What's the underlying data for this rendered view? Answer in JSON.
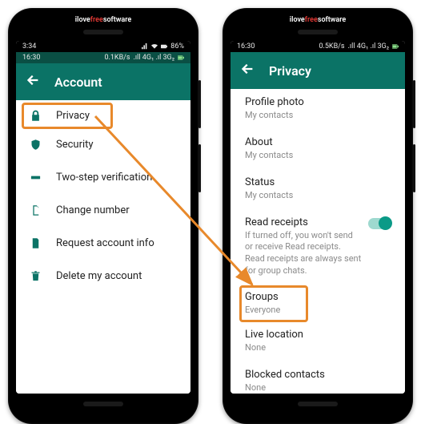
{
  "brand": {
    "pre": "ilove",
    "mid": "free",
    "post": "software"
  },
  "left": {
    "status1": {
      "time": "3:34",
      "battery": "86%"
    },
    "status2": {
      "time": "16:30",
      "net": "0.1KB/s",
      "sig": ".ıll 4G₁ .ıl 3G₂"
    },
    "header": {
      "title": "Account"
    },
    "items": [
      {
        "key": "privacy",
        "label": "Privacy"
      },
      {
        "key": "security",
        "label": "Security"
      },
      {
        "key": "twostep",
        "label": "Two-step verification"
      },
      {
        "key": "change",
        "label": "Change number"
      },
      {
        "key": "request",
        "label": "Request account info"
      },
      {
        "key": "delete",
        "label": "Delete my account"
      }
    ]
  },
  "right": {
    "status2": {
      "time": "16:30",
      "net": "0.5KB/s",
      "sig": ".ıll 4G₁ .ıl 3G₂"
    },
    "header": {
      "title": "Privacy"
    },
    "sections": {
      "profile": {
        "label": "Profile photo",
        "sub": "My contacts"
      },
      "about": {
        "label": "About",
        "sub": "My contacts"
      },
      "status": {
        "label": "Status",
        "sub": "My contacts"
      },
      "read": {
        "label": "Read receipts",
        "sub": "If turned off, you won't send or receive Read receipts. Read receipts are always sent for group chats."
      },
      "groups": {
        "label": "Groups",
        "sub": "Everyone"
      },
      "live": {
        "label": "Live location",
        "sub": "None"
      },
      "blocked": {
        "label": "Blocked contacts",
        "sub": "None"
      }
    }
  }
}
